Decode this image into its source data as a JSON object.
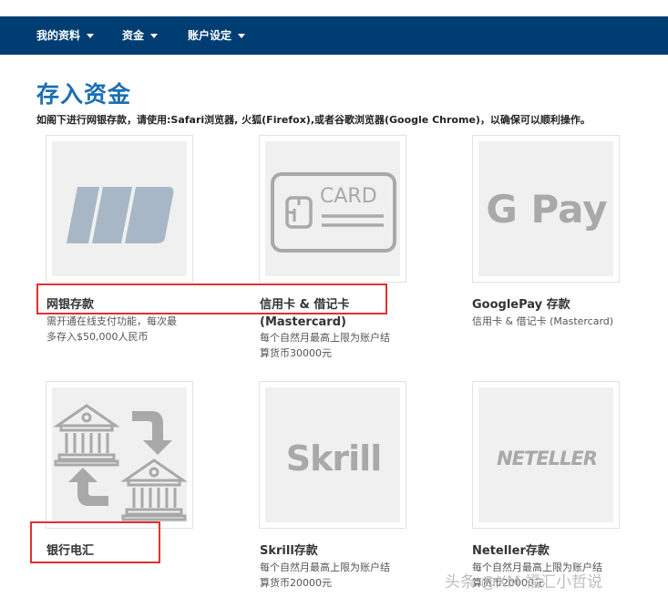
{
  "nav": {
    "items": [
      {
        "label": "我的资料"
      },
      {
        "label": "资金"
      },
      {
        "label": "账户设定"
      }
    ]
  },
  "page": {
    "title": "存入资金",
    "subtitle": "如阁下进行网银存款，请使用:Safari浏览器, 火狐(Firefox),或者谷歌浏览器(Google Chrome)，以确保可以顺利操作。"
  },
  "methods": [
    {
      "title": "网银存款",
      "desc": [
        "需开通在线支付功能，每次最",
        "多存入$50,000人民币"
      ],
      "icon": "bank-card-icon"
    },
    {
      "title": [
        "信用卡 & 借记卡",
        "(Mastercard)"
      ],
      "desc": [
        "每个自然月最高上限为账户结",
        "算货币30000元"
      ],
      "icon": "credit-card-icon",
      "icon_text": "CARD"
    },
    {
      "title": "GooglePay 存款",
      "desc": [
        "信用卡 & 借记卡 (Mastercard)"
      ],
      "icon": "google-pay-icon",
      "icon_text": "G Pay"
    },
    {
      "title": "银行电汇",
      "desc": [],
      "icon": "bank-transfer-icon"
    },
    {
      "title": "Skrill存款",
      "desc": [
        "每个自然月最高上限为账户结",
        "算货币20000元"
      ],
      "icon": "skrill-icon",
      "icon_text": "Skrill"
    },
    {
      "title": "Neteller存款",
      "desc": [
        "每个自然月最高上限为账户结",
        "算货币20000元"
      ],
      "icon": "neteller-icon",
      "icon_text": "NETELLER"
    }
  ],
  "watermark": "头条 @XM 福汇小哲说",
  "colors": {
    "nav_bg": "#003d73",
    "title": "#1a6fb3",
    "highlight": "#e03131",
    "icon_gray": "#a9a9a9",
    "bank_card_blue": "#a7b7c6"
  }
}
